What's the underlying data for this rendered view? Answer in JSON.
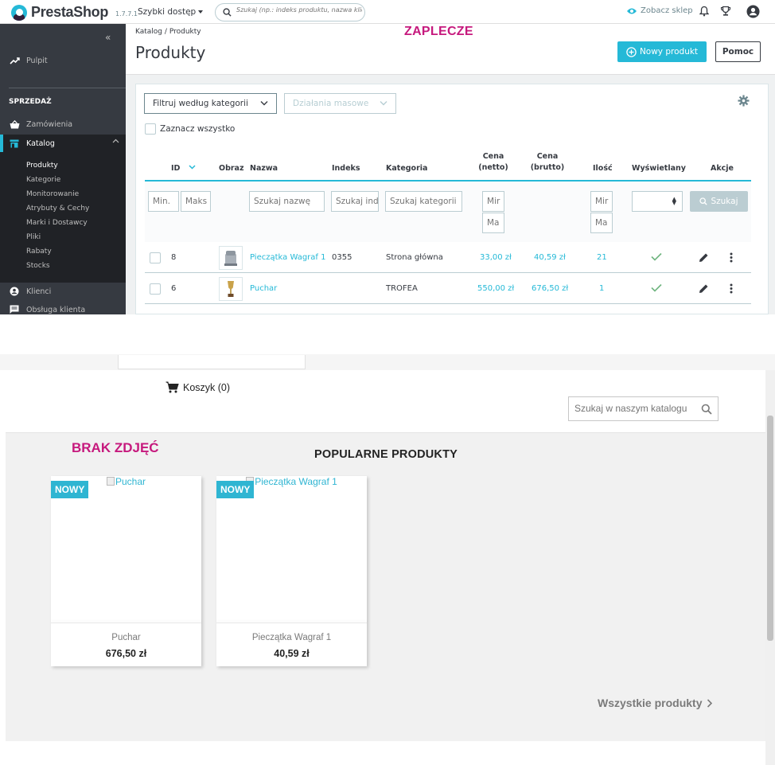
{
  "admin": {
    "brand": "PrestaShop",
    "version": "1.7.7.1",
    "quick_access": "Szybki dostęp",
    "search_placeholder": "Szukaj (np.: indeks produktu, nazwa klie",
    "see_store": "Zobacz sklep",
    "collapse_glyph": "«",
    "sidebar": {
      "dashboard": "Pulpit",
      "section_sales": "SPRZEDAŻ",
      "orders": "Zamówienia",
      "catalog": "Katalog",
      "catalog_sub": [
        "Produkty",
        "Kategorie",
        "Monitorowanie",
        "Atrybuty & Cechy",
        "Marki i Dostawcy",
        "Pliki",
        "Rabaty",
        "Stocks"
      ],
      "customers": "Klienci",
      "customer_service": "Obsługa klienta"
    },
    "breadcrumb": [
      "Katalog",
      "Produkty"
    ],
    "breadcrumb_sep": "/",
    "page_title": "Produkty",
    "annotation": "ZAPLECZE",
    "new_product": "Nowy produkt",
    "help": "Pomoc",
    "filter_category": "Filtruj według kategorii",
    "bulk_actions": "Działania masowe",
    "select_all": "Zaznacz wszystko",
    "columns": {
      "id": "ID",
      "image": "Obraz",
      "name": "Nazwa",
      "reference": "Indeks",
      "category": "Kategoria",
      "price_net_1": "Cena",
      "price_net_2": "(netto)",
      "price_gross_1": "Cena",
      "price_gross_2": "(brutto)",
      "quantity": "Ilość",
      "status": "Wyświetlany",
      "actions": "Akcje"
    },
    "filters": {
      "id_min": "Min.",
      "id_max": "Maks",
      "name": "Szukaj nazwę",
      "reference": "Szukaj ind",
      "category": "Szukaj kategorii",
      "price_min": "Mir",
      "price_max": "Ma",
      "qty_min": "Mir",
      "qty_max": "Ma",
      "search_button": "Szukaj"
    },
    "products": [
      {
        "id": "8",
        "name": "Pieczątka Wagraf 1",
        "reference": "0355",
        "category": "Strona główna",
        "price_net": "33,00 zł",
        "price_gross": "40,59 zł",
        "quantity": "21"
      },
      {
        "id": "6",
        "name": "Puchar",
        "reference": "",
        "category": "TROFEA",
        "price_net": "550,00 zł",
        "price_gross": "676,50 zł",
        "quantity": "1"
      }
    ],
    "accent_color": "#25b9d7",
    "annotation_color": "#c6197d"
  },
  "store": {
    "cart": "Koszyk (0)",
    "search_placeholder": "Szukaj w naszym katalogu",
    "annotation": "BRAK ZDJĘĆ",
    "section_title": "POPULARNE PRODUKTY",
    "products": [
      {
        "alt": "Puchar",
        "flag": "NOWY",
        "name": "Puchar",
        "price": "676,50 zł"
      },
      {
        "alt": "Pieczątka Wagraf 1",
        "flag": "NOWY",
        "name": "Pieczątka Wagraf 1",
        "price": "40,59 zł"
      }
    ],
    "all_products": "Wszystkie produkty",
    "accent_color": "#2fb5d2"
  }
}
